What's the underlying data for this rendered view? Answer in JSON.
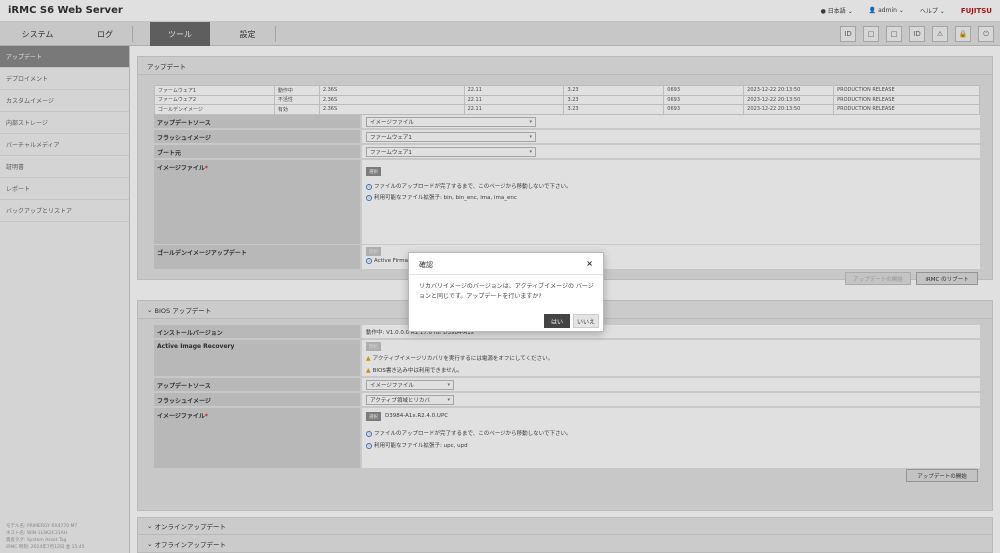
{
  "header": {
    "app_title": "iRMC S6 Web Server",
    "lang": "日本語",
    "user": "admin",
    "help": "ヘルプ",
    "brand": "FUJITSU"
  },
  "nav": {
    "tabs": [
      "システム",
      "ログ",
      "ツール",
      "設定"
    ]
  },
  "status_icons": [
    "ID",
    "□",
    "□",
    "ID",
    "⚠",
    "🔒",
    "⏻"
  ],
  "sidebar": {
    "items": [
      "アップデート",
      "デプロイメント",
      "カスタムイメージ",
      "内部ストレージ",
      "バーチャルメディア",
      "証明書",
      "レポート",
      "バックアップとリストア"
    ],
    "info": [
      "モデル名: PRIMERGY RX4770 M7",
      "ホスト名: WIN-1LSK2C31AH",
      "資産タグ: System Asset Tag",
      "iRMC 時刻: 2024年7月12日 金 15:45"
    ]
  },
  "irmc_section": {
    "title": "アップデート",
    "fw_rows": [
      [
        "ファームウェア1",
        "動作中",
        "2.36S",
        "22.11",
        "3.23",
        "0693",
        "2023-12-22 20:13:50",
        "PRODUCTION RELEASE"
      ],
      [
        "ファームウェア2",
        "不活性",
        "2.36S",
        "22.11",
        "3.23",
        "0693",
        "2023-12-22 20:13:50",
        "PRODUCTION RELEASE"
      ],
      [
        "ゴールデンイメージ",
        "有効",
        "2.36S",
        "22.11",
        "3.23",
        "0693",
        "2023-12-22 20:13:50",
        "PRODUCTION RELEASE"
      ]
    ],
    "update_source_label": "アップデートソース",
    "update_source_value": "イメージファイル",
    "flash_image_label": "フラッシュイメージ",
    "flash_image_value": "ファームウェア1",
    "boot_label": "ブート元",
    "boot_value": "ファームウェア1",
    "image_file_label": "イメージファイル",
    "required_mark": "*",
    "browse_label": "選択",
    "info1": "ファイルのアップロードが完了するまで、このページから移動しないで下さい。",
    "info2": "利用可能なファイル拡張子: bin, bin_enc, ima, ima_enc",
    "golden_label": "ゴールデンイメージアップデート",
    "golden_btn": "開始",
    "golden_info": "Active Firmware and the Golden Image are identical",
    "start_update_btn": "アップデートの開始",
    "reboot_btn": "iRMC のリブート"
  },
  "bios_section": {
    "title": "BIOS アップデート",
    "installed_label": "インストールバージョン",
    "installed_value": "動作中: V1.0.0.0 R1.17.0 for D3984-A1x",
    "air_label": "Active Image Recovery",
    "air_btn": "開始",
    "warn1": "アクティブイメージリカバリを実行するには電源をオフにしてください。",
    "warn2": "BIOS書き込み中は利用できません。",
    "update_source_label": "アップデートソース",
    "update_source_value": "イメージファイル",
    "flash_image_label": "フラッシュイメージ",
    "flash_image_value": "アクティブ領域とリカバ",
    "image_file_label": "イメージファイル",
    "required_mark": "*",
    "browse_label": "選択",
    "file_name": "D3984-A1x.R2.4.0.UPC",
    "info1": "ファイルのアップロードが完了するまで、このページから移動しないで下さい。",
    "info2": "利用可能なファイル拡張子: upc, upd",
    "start_update_btn": "アップデートの開始"
  },
  "online_section": {
    "title": "オンラインアップデート"
  },
  "offline_section": {
    "title": "オフラインアップデート"
  },
  "dialog": {
    "title": "確認",
    "close": "×",
    "message": "リカバリイメージのバージョンは、アクティブイメージの バージョンと同じです。アップデートを行いますか?",
    "yes": "はい",
    "no": "いいえ"
  }
}
